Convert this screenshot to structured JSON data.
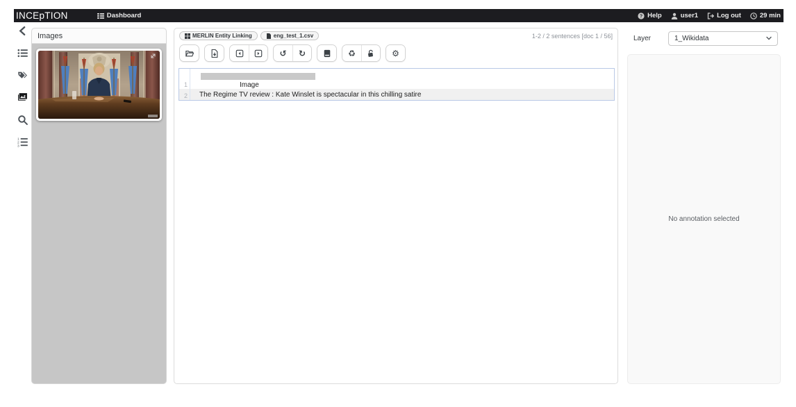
{
  "topbar": {
    "brand": "INCEpTION",
    "dashboard_label": "Dashboard",
    "help_label": "Help",
    "username": "user1",
    "logout_label": "Log out",
    "session_time": "29 min",
    "icons": [
      "dashboard-list-icon",
      "help-icon",
      "user-icon",
      "logout-icon",
      "clock-icon"
    ]
  },
  "sidebar": {
    "icons": [
      "collapse-chevron-left-icon",
      "document-list-icon",
      "tags-icon",
      "images-icon",
      "search-icon",
      "ordered-list-icon"
    ],
    "active_icon": "images-icon"
  },
  "images_panel": {
    "title": "Images"
  },
  "main": {
    "project_badge": "MERLIN Entity Linking",
    "document_badge": "eng_test_1.csv",
    "pagination": "1-2 / 2 sentences [doc 1 / 56]",
    "toolbar_icons": [
      "open-document-icon",
      "export-document-icon",
      "prev-document-icon",
      "next-document-icon",
      "undo-icon",
      "redo-icon",
      "guidelines-icon",
      "reset-icon",
      "unlock-icon",
      "settings-icon"
    ],
    "rows": [
      {
        "number": "1",
        "text": "Image",
        "has_annotation_block": "true"
      },
      {
        "number": "2",
        "text": "The Regime TV review : Kate Winslet is spectacular in this chilling satire",
        "has_annotation_block": "false"
      }
    ]
  },
  "right_panel": {
    "layer_label": "Layer",
    "layer_value": "1_Wikidata",
    "empty_message": "No annotation selected"
  },
  "colors": {
    "topbar_bg": "#1c1c20",
    "sentence_box_border": "#b9c9e6",
    "annotation_block": "#c9c9c9",
    "images_panel_bg": "#c6c6c6",
    "alt_row_bg": "#f0f0f0"
  },
  "glyphs": {
    "undo": "↺",
    "redo": "↻",
    "reset": "♻",
    "settings": "⚙"
  }
}
